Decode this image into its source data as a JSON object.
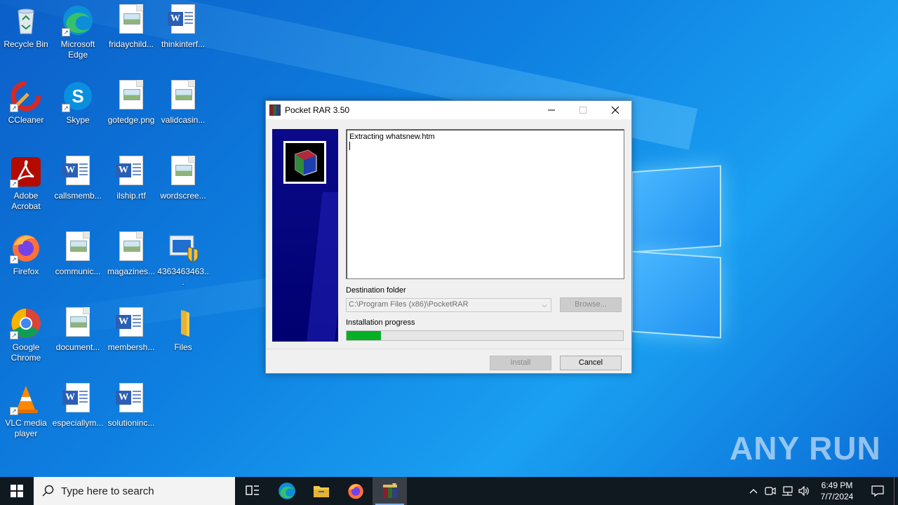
{
  "desktop": {
    "icons": [
      {
        "label": "Recycle Bin",
        "icon": "recycle-bin-icon"
      },
      {
        "label": "Microsoft Edge",
        "icon": "edge-icon"
      },
      {
        "label": "fridaychild...",
        "icon": "image-file-icon"
      },
      {
        "label": "thinkinterf...",
        "icon": "word-doc-icon"
      },
      {
        "label": "CCleaner",
        "icon": "ccleaner-icon"
      },
      {
        "label": "Skype",
        "icon": "skype-icon"
      },
      {
        "label": "gotedge.png",
        "icon": "image-file-icon"
      },
      {
        "label": "validcasin...",
        "icon": "image-file-icon"
      },
      {
        "label": "Adobe Acrobat",
        "icon": "acrobat-icon"
      },
      {
        "label": "callsmemb...",
        "icon": "word-doc-icon"
      },
      {
        "label": "ilship.rtf",
        "icon": "word-doc-icon"
      },
      {
        "label": "wordscree...",
        "icon": "image-file-icon"
      },
      {
        "label": "Firefox",
        "icon": "firefox-icon"
      },
      {
        "label": "communic...",
        "icon": "image-file-icon"
      },
      {
        "label": "magazines...",
        "icon": "image-file-icon"
      },
      {
        "label": "4363463463...",
        "icon": "installer-icon"
      },
      {
        "label": "Google Chrome",
        "icon": "chrome-icon"
      },
      {
        "label": "document...",
        "icon": "image-file-icon"
      },
      {
        "label": "membersh...",
        "icon": "word-doc-icon"
      },
      {
        "label": "Files",
        "icon": "folder-icon"
      },
      {
        "label": "VLC media player",
        "icon": "vlc-icon"
      },
      {
        "label": "especiallym...",
        "icon": "word-doc-icon"
      },
      {
        "label": "solutioninc...",
        "icon": "word-doc-icon"
      }
    ]
  },
  "dialog": {
    "title": "Pocket RAR 3.50",
    "log_text": "Extracting whatsnew.htm",
    "destination_label": "Destination folder",
    "destination_value": "C:\\Program Files (x86)\\PocketRAR",
    "browse_label": "Browse...",
    "progress_label": "Installation progress",
    "progress_fraction": 0.125,
    "install_label": "Install",
    "cancel_label": "Cancel"
  },
  "watermark": "ANY RUN",
  "taskbar": {
    "search_placeholder": "Type here to search",
    "apps": [
      "task-view-icon",
      "edge-icon",
      "file-explorer-icon",
      "firefox-icon",
      "pocketrar-icon"
    ],
    "time": "6:49 PM",
    "date": "7/7/2024"
  },
  "colors": {
    "progress_fill": "#06b025",
    "side_panel": "#000070"
  }
}
